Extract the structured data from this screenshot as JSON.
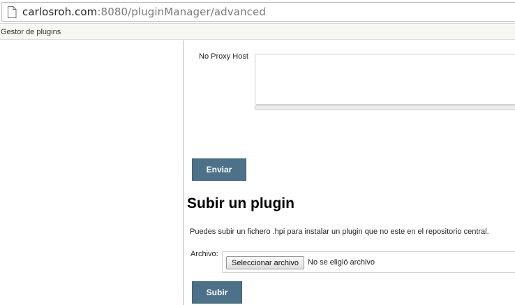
{
  "browser": {
    "url_host": "carlosroh.com",
    "url_rest": ":8080/pluginManager/advanced",
    "page_icon": "document-icon"
  },
  "breadcrumb": {
    "label": "Gestor de plugins"
  },
  "proxy": {
    "no_proxy_label": "No Proxy Host",
    "no_proxy_value": ""
  },
  "proxy_form": {
    "submit_label": "Enviar"
  },
  "upload": {
    "title": "Subir un plugin",
    "description": "Puedes subir un fichero .hpi para instalar un plugin que no este en el repositorio central.",
    "file_label": "Archivo:",
    "choose_button_label": "Seleccionar archivo",
    "no_file_text": "No se eligió archivo",
    "submit_label": "Subir"
  },
  "colors": {
    "button_bg": "#4c7189",
    "button_text": "#ffffff",
    "breadcrumb_bg": "#f5f7f0"
  }
}
